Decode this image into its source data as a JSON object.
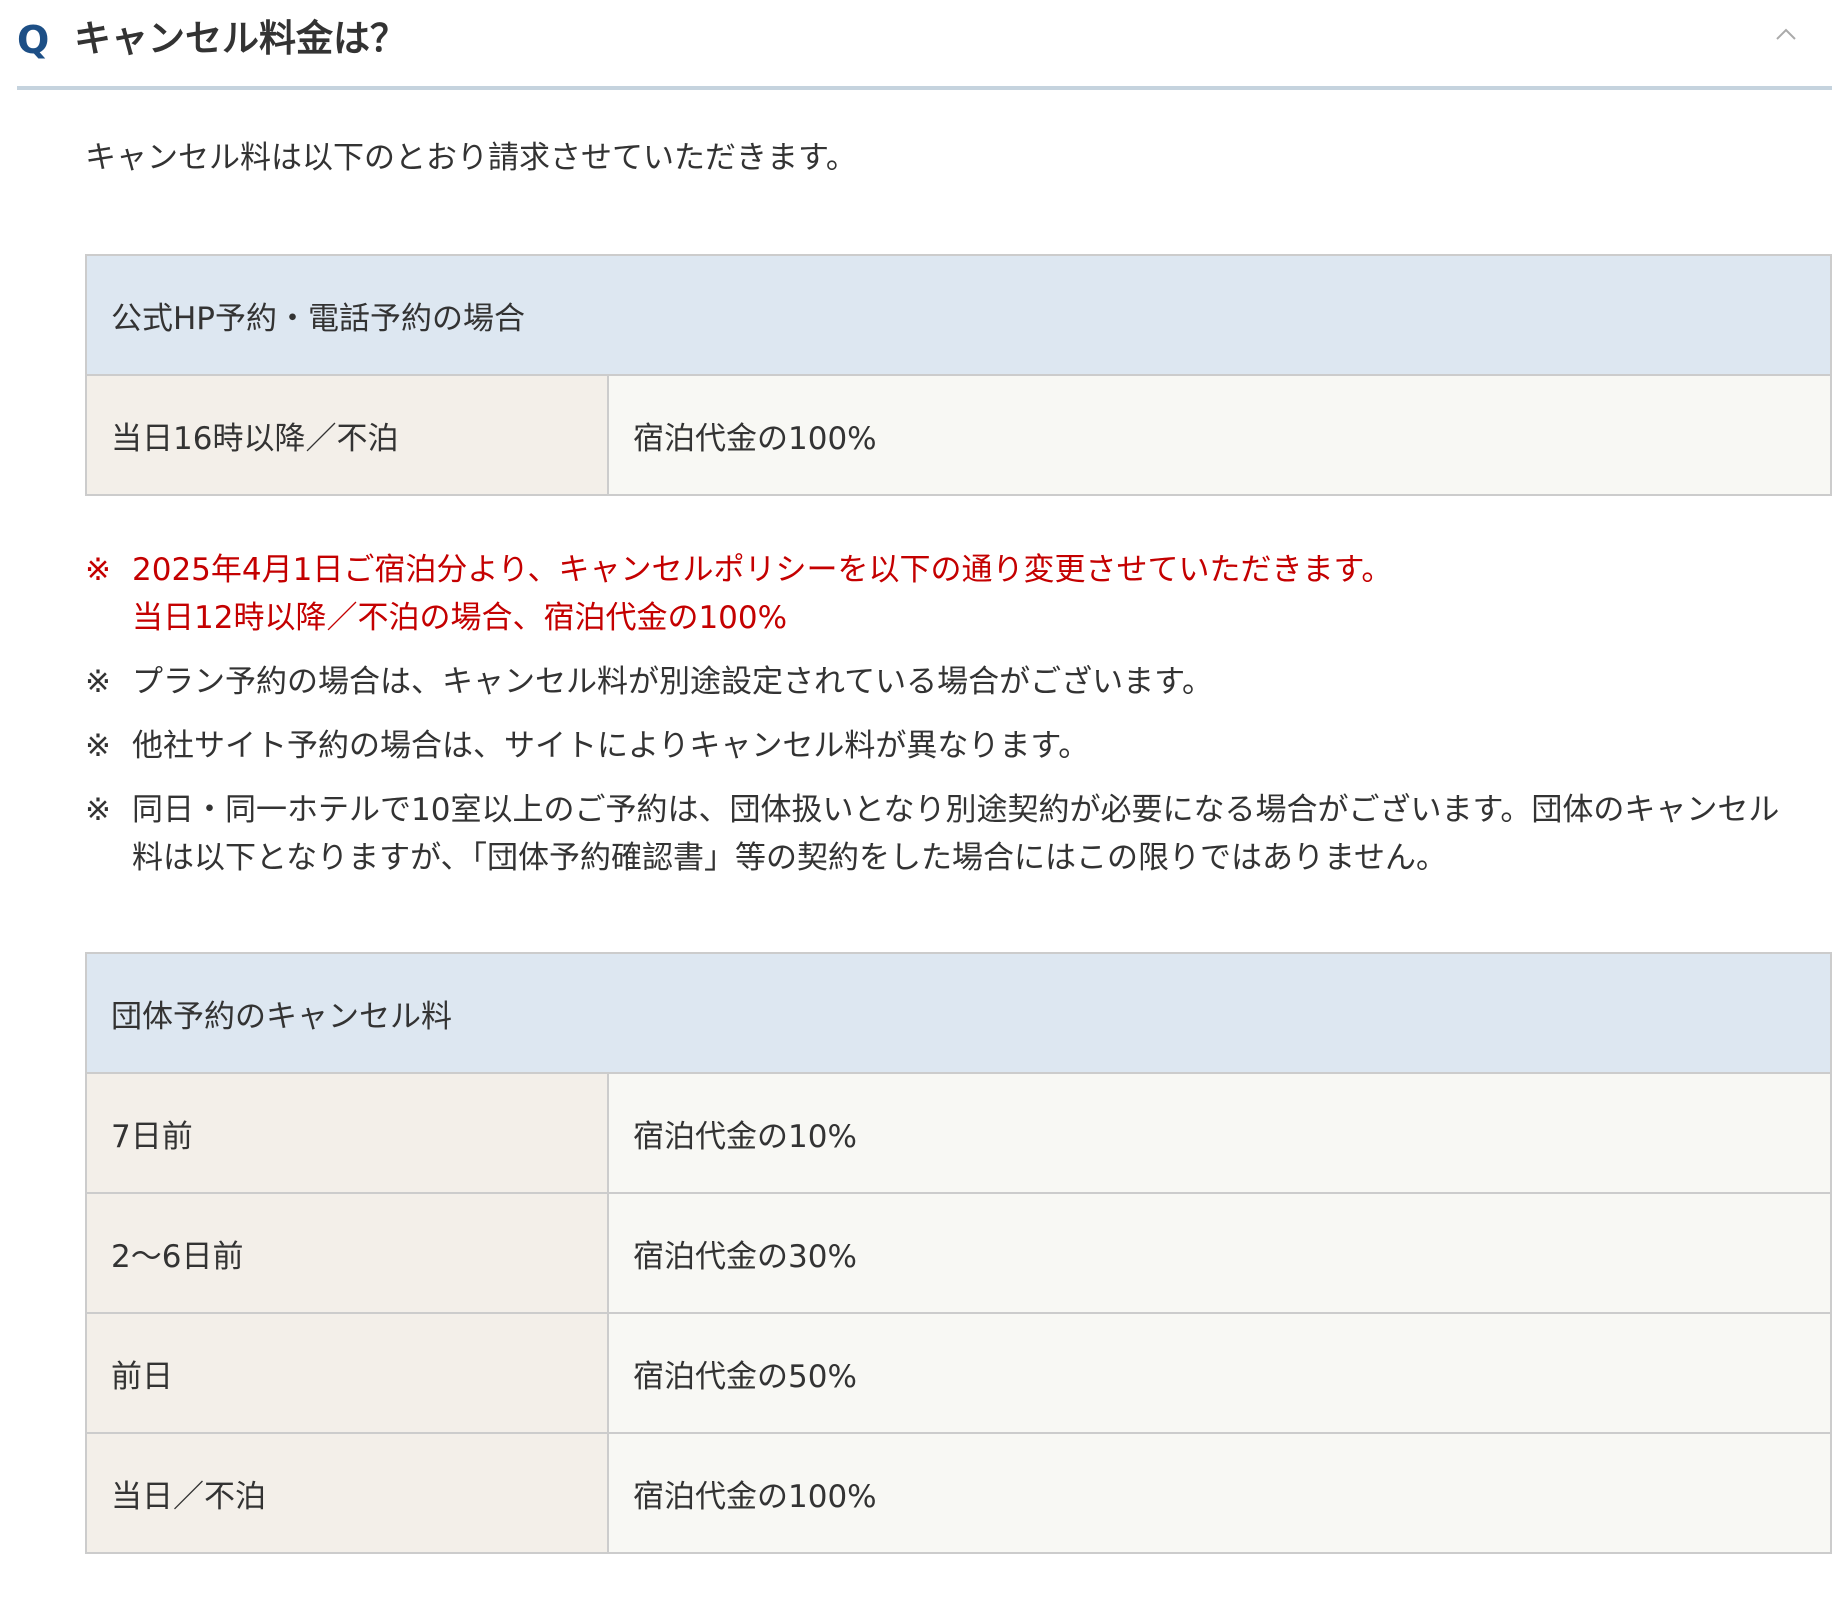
{
  "question": {
    "q_mark": "Q",
    "title": "キャンセル料金は？",
    "toggle_icon": "chevron-up-icon"
  },
  "intro": "キャンセル料は以下のとおり請求させていただきます。",
  "table_official": {
    "header": "公式HP予約・電話予約の場合",
    "rows": [
      {
        "label": "当日16時以降／不泊",
        "value": "宿泊代金の100%"
      }
    ]
  },
  "notes": [
    {
      "mark": "※",
      "lines": [
        "2025年4月1日ご宿泊分より、キャンセルポリシーを以下の通り変更させていただきます。",
        "当日12時以降／不泊の場合、宿泊代金の100%"
      ],
      "color": "#c40000"
    },
    {
      "mark": "※",
      "lines": [
        "プラン予約の場合は、キャンセル料が別途設定されている場合がございます。"
      ]
    },
    {
      "mark": "※",
      "lines": [
        "他社サイト予約の場合は、サイトによりキャンセル料が異なります。"
      ]
    },
    {
      "mark": "※",
      "lines": [
        "同日・同一ホテルで10室以上のご予約は、団体扱いとなり別途契約が必要になる場合がございます。団体のキャンセル",
        "料は以下となりますが、「団体予約確認書」等の契約をした場合にはこの限りではありません。"
      ]
    }
  ],
  "table_group": {
    "header": "団体予約のキャンセル料",
    "rows": [
      {
        "label": "7日前",
        "value": "宿泊代金の10%"
      },
      {
        "label": "2〜6日前",
        "value": "宿泊代金の30%"
      },
      {
        "label": "前日",
        "value": "宿泊代金の50%"
      },
      {
        "label": "当日／不泊",
        "value": "宿泊代金の100%"
      }
    ]
  },
  "colors": {
    "q_blue": "#1d4f86",
    "header_bg": "#dde7f1",
    "label_bg": "#f3efe9",
    "value_bg": "#f8f8f4",
    "notice_red": "#c40000",
    "divider": "#c5d3de"
  }
}
